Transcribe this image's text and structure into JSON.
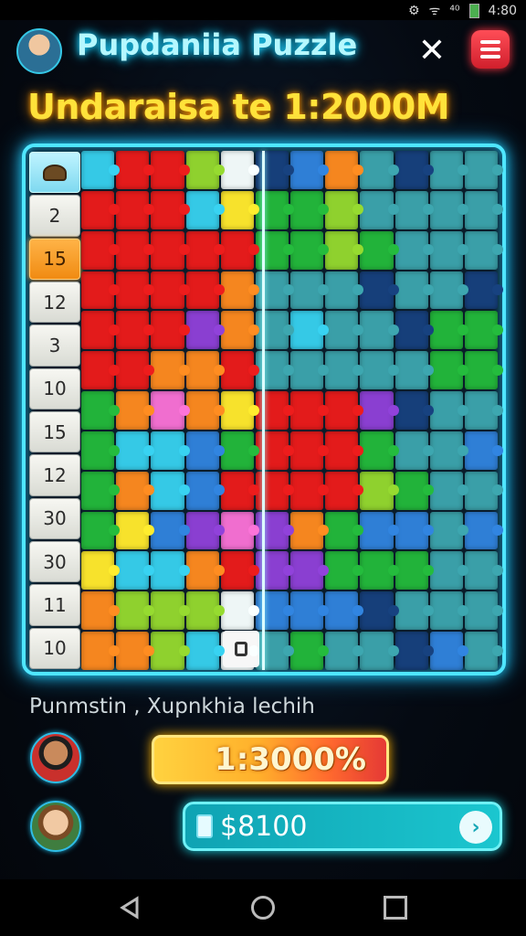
{
  "status_bar": {
    "signal": "ᯤ",
    "network": "⁴⁰",
    "time": "4:80"
  },
  "header": {
    "title": "Pupdaniia Puzzle",
    "close_glyph": "✕",
    "subtitle": "Undaraisa te 1:2000M"
  },
  "board": {
    "row_numbers": [
      "2",
      "15",
      "12",
      "3",
      "10",
      "15",
      "12",
      "30",
      "30",
      "11",
      "10"
    ],
    "active_row_index": 1,
    "palette": {
      "red": "#e31b1b",
      "orange": "#f5861f",
      "yellow": "#f7e22c",
      "green": "#22b33a",
      "lime": "#8fd12e",
      "cyan": "#35c9e6",
      "blue": "#2f7fd6",
      "navy": "#163f7a",
      "teal": "#3a9fa8",
      "purple": "#8a3fd1",
      "pink": "#f06ecf",
      "white": "#eef6f6"
    },
    "rows": [
      [
        "cyan",
        "red",
        "red",
        "lime",
        "white",
        "navy",
        "blue",
        "orange",
        "teal",
        "navy",
        "teal",
        "teal"
      ],
      [
        "red",
        "red",
        "red",
        "cyan",
        "yellow",
        "green",
        "green",
        "lime",
        "teal",
        "teal",
        "teal",
        "teal"
      ],
      [
        "red",
        "red",
        "red",
        "red",
        "red",
        "green",
        "green",
        "lime",
        "green",
        "teal",
        "teal",
        "teal"
      ],
      [
        "red",
        "red",
        "red",
        "red",
        "orange",
        "teal",
        "teal",
        "teal",
        "navy",
        "teal",
        "teal",
        "navy"
      ],
      [
        "red",
        "red",
        "red",
        "purple",
        "orange",
        "teal",
        "cyan",
        "teal",
        "teal",
        "navy",
        "green",
        "green"
      ],
      [
        "red",
        "red",
        "orange",
        "orange",
        "red",
        "teal",
        "teal",
        "teal",
        "teal",
        "teal",
        "green",
        "green"
      ],
      [
        "green",
        "orange",
        "pink",
        "orange",
        "yellow",
        "red",
        "red",
        "red",
        "purple",
        "navy",
        "teal",
        "teal"
      ],
      [
        "green",
        "cyan",
        "cyan",
        "blue",
        "green",
        "red",
        "red",
        "red",
        "green",
        "teal",
        "teal",
        "blue"
      ],
      [
        "green",
        "orange",
        "cyan",
        "blue",
        "red",
        "red",
        "red",
        "red",
        "lime",
        "green",
        "teal",
        "teal"
      ],
      [
        "green",
        "yellow",
        "blue",
        "purple",
        "pink",
        "purple",
        "orange",
        "green",
        "blue",
        "blue",
        "teal",
        "blue"
      ],
      [
        "yellow",
        "cyan",
        "cyan",
        "orange",
        "red",
        "purple",
        "purple",
        "green",
        "green",
        "green",
        "teal",
        "teal"
      ],
      [
        "orange",
        "lime",
        "lime",
        "lime",
        "white",
        "blue",
        "blue",
        "blue",
        "navy",
        "teal",
        "teal",
        "teal"
      ],
      [
        "orange",
        "orange",
        "lime",
        "cyan",
        "white",
        "teal",
        "green",
        "teal",
        "teal",
        "navy",
        "blue",
        "teal"
      ]
    ]
  },
  "footer": {
    "caption": "Punmstin , Xupnkhia lechih",
    "progress_label": "1:3000%",
    "progress_fraction": 0.85,
    "money_label": "$8100",
    "go_glyph": "›"
  },
  "colors": {
    "accent_cyan": "#4fe6ff",
    "title_yellow": "#ffe23a",
    "menu_red": "#e02a36"
  }
}
